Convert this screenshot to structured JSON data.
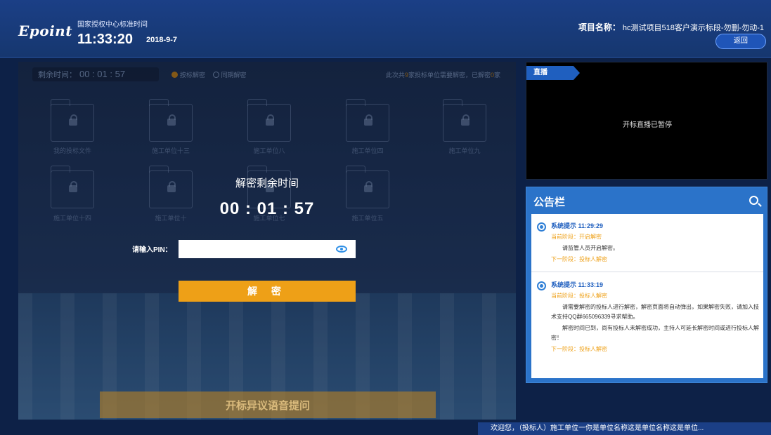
{
  "header": {
    "logo": "Epoint",
    "time_label": "国家授权中心标准时间",
    "time": "11:33:20",
    "date": "2018-9-7",
    "project_label": "项目名称：",
    "project_name": "hc测试项目518客户演示标段-勿删-勿动-1",
    "back_label": "返回"
  },
  "main": {
    "remain_label": "剩余时间：",
    "remain_value": "00 : 01 : 57",
    "mode_on": "按标解密",
    "mode_off": "同期解密",
    "stat_prefix": "此次共",
    "stat_count": "9",
    "stat_mid": "家投标单位需要解密，已解密",
    "stat_done": "0",
    "stat_suffix": "家",
    "folders": [
      "我的投标文件",
      "施工单位十三",
      "施工单位八",
      "施工单位四",
      "施工单位九",
      "施工单位十四",
      "施工单位十",
      "施工单位七",
      "施工单位五"
    ],
    "dialog_title": "解密剩余时间",
    "dialog_time": "00 : 01 : 57",
    "pin_label": "请输入PIN：",
    "pin_value": "",
    "decrypt_label": "解 密",
    "voice_label": "开标异议语音提问"
  },
  "live": {
    "tag": "直播",
    "message": "开标直播已暂停"
  },
  "notice": {
    "title": "公告栏",
    "messages": [
      {
        "who": "系统提示 11:29:29",
        "stage": "当前阶段：开启解密",
        "text": "请监管人员开启解密。",
        "next": "下一阶段：投标人解密"
      },
      {
        "who": "系统提示 11:33:19",
        "stage": "当前阶段：投标人解密",
        "text": "请需要解密的投标人进行解密，解密页面将自动弹出，如果解密失败，请加入技术支持QQ群665096339寻求帮助。",
        "text2": "解密时间已到，尚有投标人未解密成功，主持人可延长解密时间或进行投标人解密！",
        "next": "下一阶段：投标人解密"
      }
    ]
  },
  "marquee": "欢迎您，（投标人）施工单位一你是单位名称这是单位名称这是单位..."
}
